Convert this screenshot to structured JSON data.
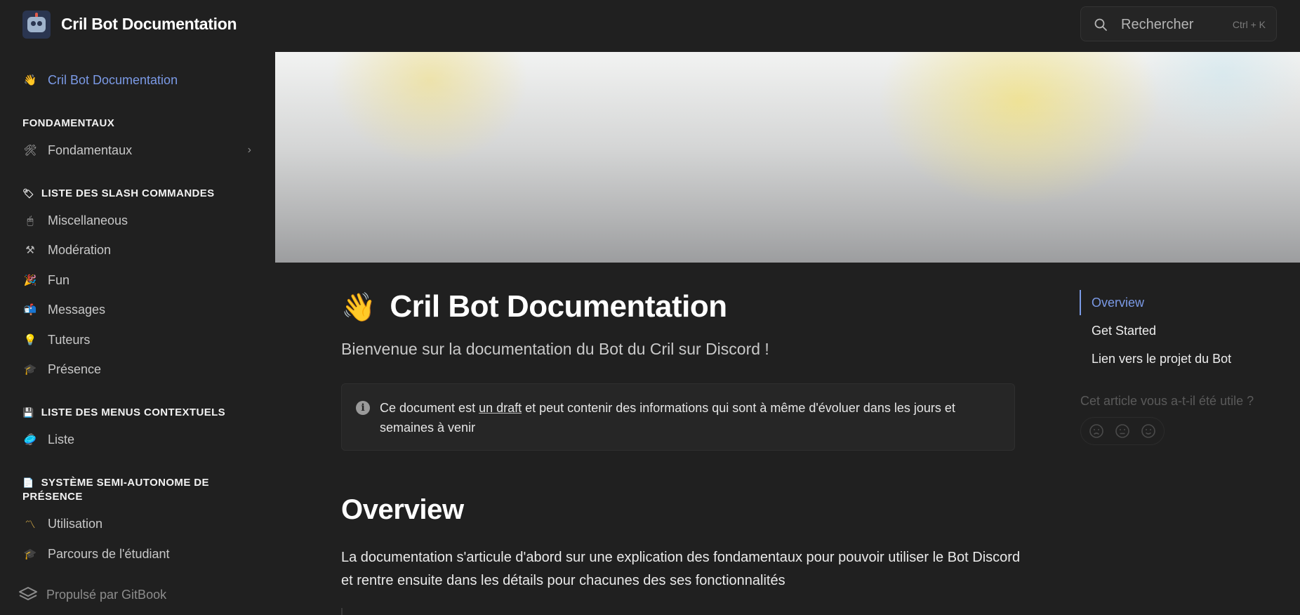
{
  "header": {
    "site_title": "Cril Bot Documentation",
    "search_placeholder": "Rechercher",
    "search_shortcut": "Ctrl + K"
  },
  "sidebar": {
    "top_link": {
      "emoji": "👋",
      "label": "Cril Bot Documentation"
    },
    "sections": [
      {
        "title": "FONDAMENTAUX",
        "emoji": "",
        "items": [
          {
            "emoji": "🛠",
            "label": "Fondamentaux",
            "has_children": true
          }
        ]
      },
      {
        "title": "LISTE DES SLASH COMMANDES",
        "emoji": "🏷",
        "items": [
          {
            "emoji": "🖱",
            "label": "Miscellaneous"
          },
          {
            "emoji": "⚒",
            "label": "Modération"
          },
          {
            "emoji": "🎉",
            "label": "Fun"
          },
          {
            "emoji": "📬",
            "label": "Messages"
          },
          {
            "emoji": "💡",
            "label": "Tuteurs"
          },
          {
            "emoji": "🎓",
            "label": "Présence"
          }
        ]
      },
      {
        "title": "LISTE DES MENUS CONTEXTUELS",
        "emoji": "💾",
        "items": [
          {
            "emoji": "🥏",
            "label": "Liste"
          }
        ]
      },
      {
        "title_line1": "SYSTÈME SEMI-AUTONOME DE",
        "title_line2": "PRÉSENCE",
        "emoji": "📄",
        "items": [
          {
            "emoji": "〽",
            "label": "Utilisation"
          },
          {
            "emoji": "🎓",
            "label": "Parcours de l'étudiant"
          }
        ]
      }
    ],
    "powered_by": "Propulsé par GitBook"
  },
  "main": {
    "title_emoji": "👋",
    "title": "Cril Bot Documentation",
    "subtitle": "Bienvenue sur la documentation du Bot du Cril sur Discord !",
    "hint": {
      "before": "Ce document est ",
      "underlined": "un draft",
      "after": " et peut contenir des informations qui sont à même d'évoluer dans les jours et semaines à venir"
    },
    "section_heading": "Overview",
    "paragraph": "La documentation s'articule d'abord sur une explication des fondamentaux pour pouvoir utiliser le Bot Discord et rentre ensuite dans les détails pour chacunes des ses fonctionnalités"
  },
  "toc": {
    "items": [
      "Overview",
      "Get Started",
      "Lien vers le projet du Bot"
    ],
    "active_index": 0,
    "feedback_question": "Cet article vous a-t-il été utile ?"
  },
  "colors": {
    "background": "#202020",
    "accent": "#7b9ae6",
    "text": "#e8e8e8",
    "muted": "#8d8d8d"
  }
}
